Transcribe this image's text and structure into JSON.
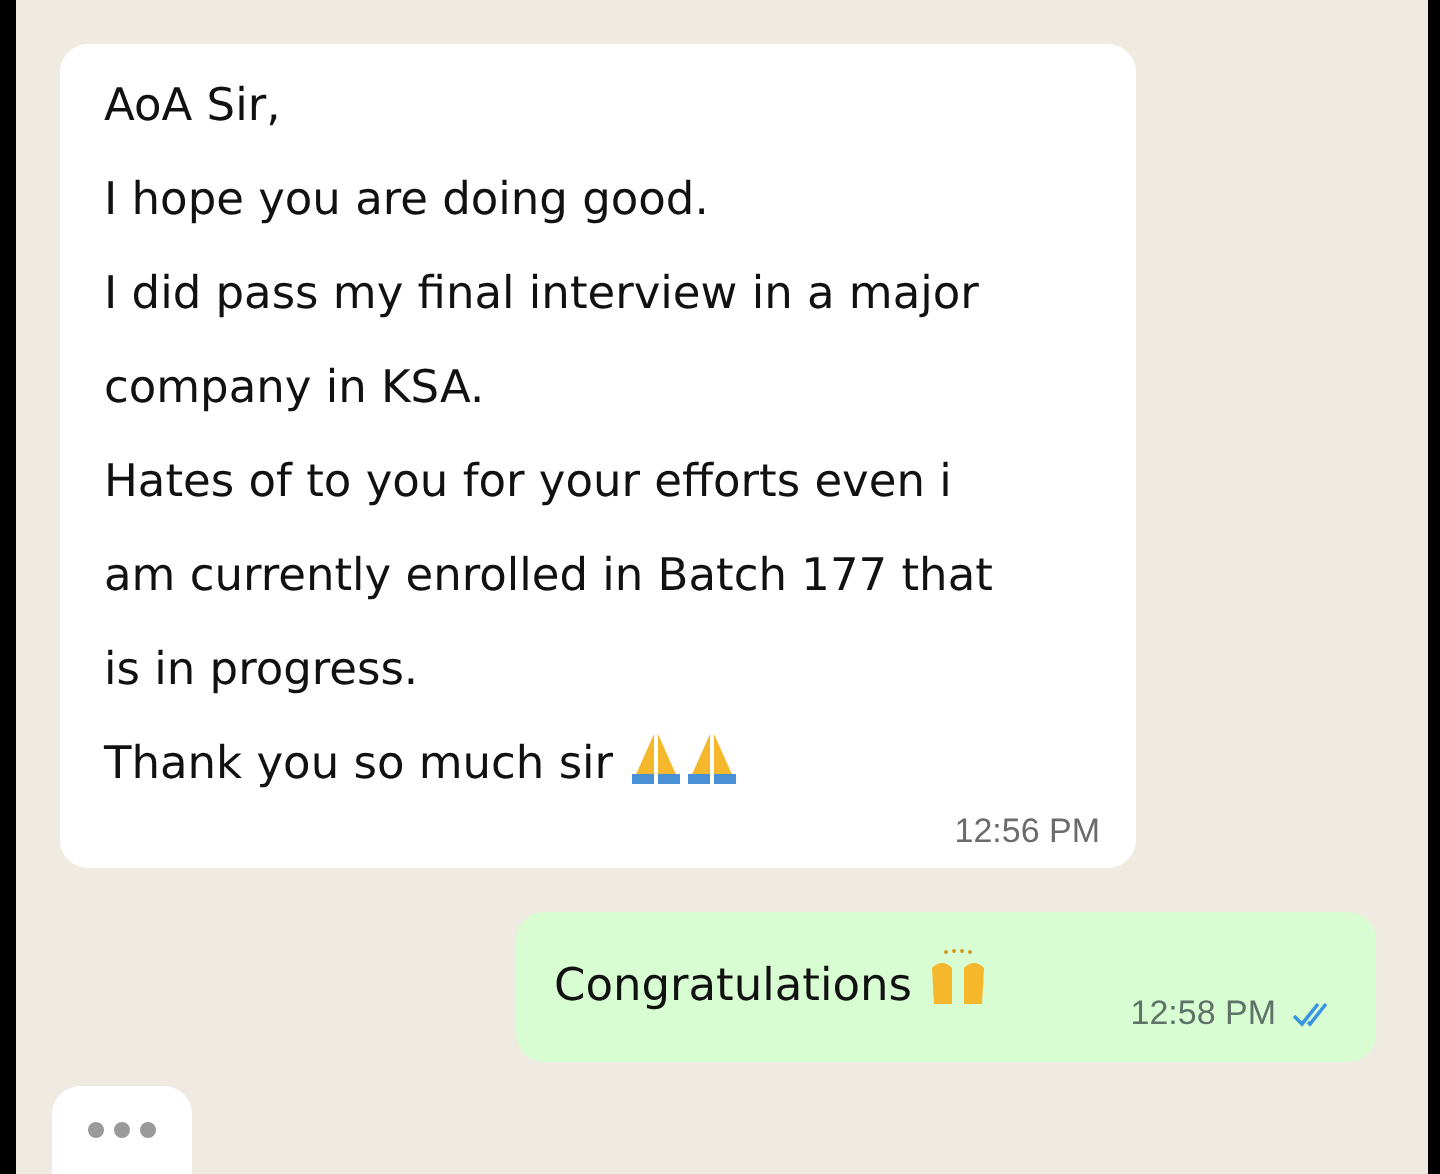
{
  "messages": [
    {
      "kind": "incoming",
      "text": "AoA Sir,\nI hope you are doing good.\nI did pass my final interview in a major company in KSA.\nHates of to you for your efforts even i am currently enrolled in Batch 177 that is in progress.\nThank you so much sir",
      "emojis": [
        {
          "kind": "pray"
        },
        {
          "kind": "pray"
        }
      ],
      "time": "12:56 PM"
    },
    {
      "kind": "outgoing",
      "text": "Congratulations",
      "emojis": [
        {
          "kind": "raised-hands"
        }
      ],
      "time": "12:58 PM",
      "read": true
    }
  ],
  "typing": true
}
